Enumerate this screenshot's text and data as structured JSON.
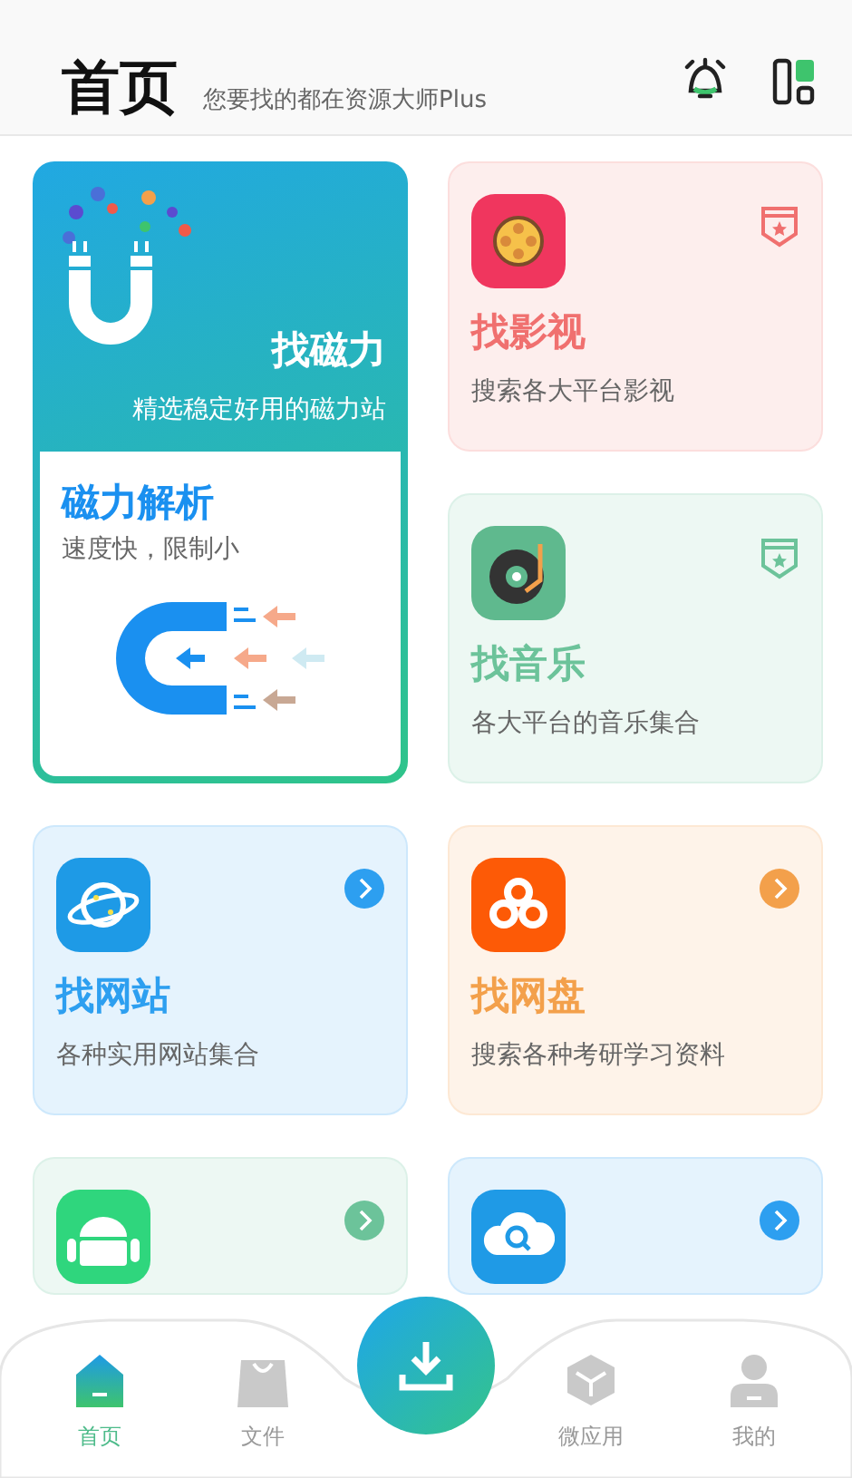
{
  "header": {
    "title": "首页",
    "subtitle": "您要找的都在资源大师Plus"
  },
  "feature": {
    "title": "找磁力",
    "subtitle": "精选稳定好用的磁力站",
    "section_title": "磁力解析",
    "section_subtitle": "速度快，限制小"
  },
  "cards": [
    {
      "kind": "badge",
      "title": "找影视",
      "subtitle": "搜索各大平台影视",
      "color": "#f0706f"
    },
    {
      "kind": "badge",
      "title": "找音乐",
      "subtitle": "各大平台的音乐集合",
      "color": "#6cc39a"
    },
    {
      "kind": "arrow",
      "title": "找网站",
      "subtitle": "各种实用网站集合",
      "color": "#2d9ff0"
    },
    {
      "kind": "arrow",
      "title": "找网盘",
      "subtitle": "搜索各种考研学习资料",
      "color": "#f3a04b"
    },
    {
      "kind": "arrow",
      "color": "#6cc39a"
    },
    {
      "kind": "arrow",
      "color": "#2d9ff0"
    }
  ],
  "nav": [
    {
      "label": "首页",
      "selected": true
    },
    {
      "label": "文件",
      "selected": false
    },
    {
      "label": "微应用",
      "selected": false
    },
    {
      "label": "我的",
      "selected": false
    }
  ]
}
